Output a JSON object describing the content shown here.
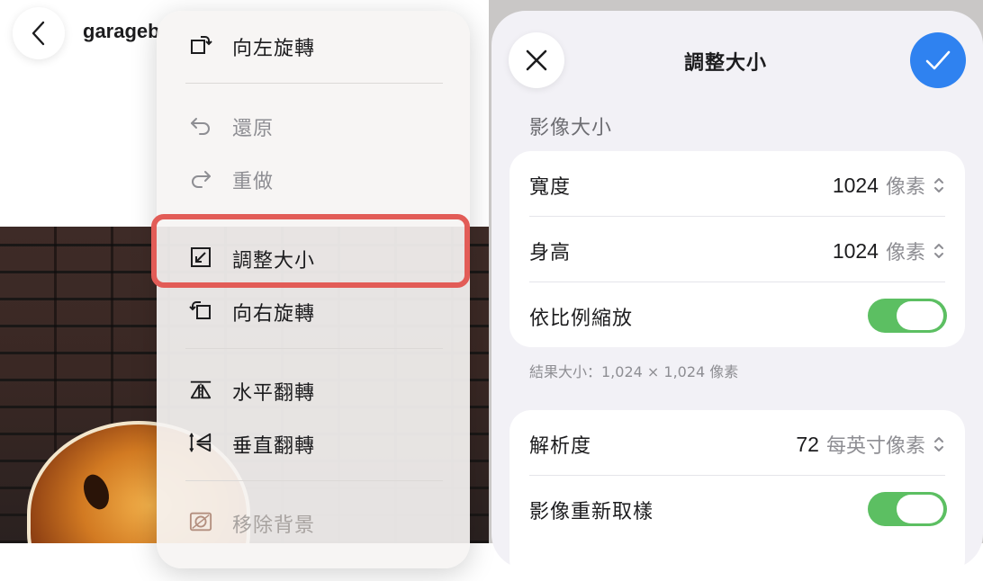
{
  "header": {
    "doc_title": "garageb",
    "back_icon": "chevron-left-icon"
  },
  "menu": {
    "items": [
      {
        "label": "向左旋轉",
        "icon": "rotate-left-icon",
        "state": "enabled"
      },
      {
        "label": "還原",
        "icon": "undo-icon",
        "state": "disabled"
      },
      {
        "label": "重做",
        "icon": "redo-icon",
        "state": "disabled"
      },
      {
        "label": "調整大小",
        "icon": "resize-icon",
        "state": "highlighted"
      },
      {
        "label": "向右旋轉",
        "icon": "rotate-right-icon",
        "state": "enabled"
      },
      {
        "label": "水平翻轉",
        "icon": "flip-horizontal-icon",
        "state": "enabled"
      },
      {
        "label": "垂直翻轉",
        "icon": "flip-vertical-icon",
        "state": "enabled"
      },
      {
        "label": "移除背景",
        "icon": "remove-background-icon",
        "state": "dim"
      }
    ]
  },
  "resize_sheet": {
    "title": "調整大小",
    "close_icon": "close-icon",
    "confirm_icon": "checkmark-icon",
    "section_label": "影像大小",
    "width": {
      "label": "寬度",
      "value": "1024",
      "unit": "像素"
    },
    "height": {
      "label": "身高",
      "value": "1024",
      "unit": "像素"
    },
    "keep_ratio": {
      "label": "依比例縮放",
      "on": true
    },
    "result_text": "結果大小：1,024 × 1,024 像素",
    "resolution": {
      "label": "解析度",
      "value": "72",
      "unit": "每英寸像素"
    },
    "resample": {
      "label": "影像重新取樣",
      "on": true
    }
  },
  "colors": {
    "accent_blue": "#2f82f0",
    "toggle_green": "#5cbf62",
    "highlight_red": "#e25c57"
  }
}
